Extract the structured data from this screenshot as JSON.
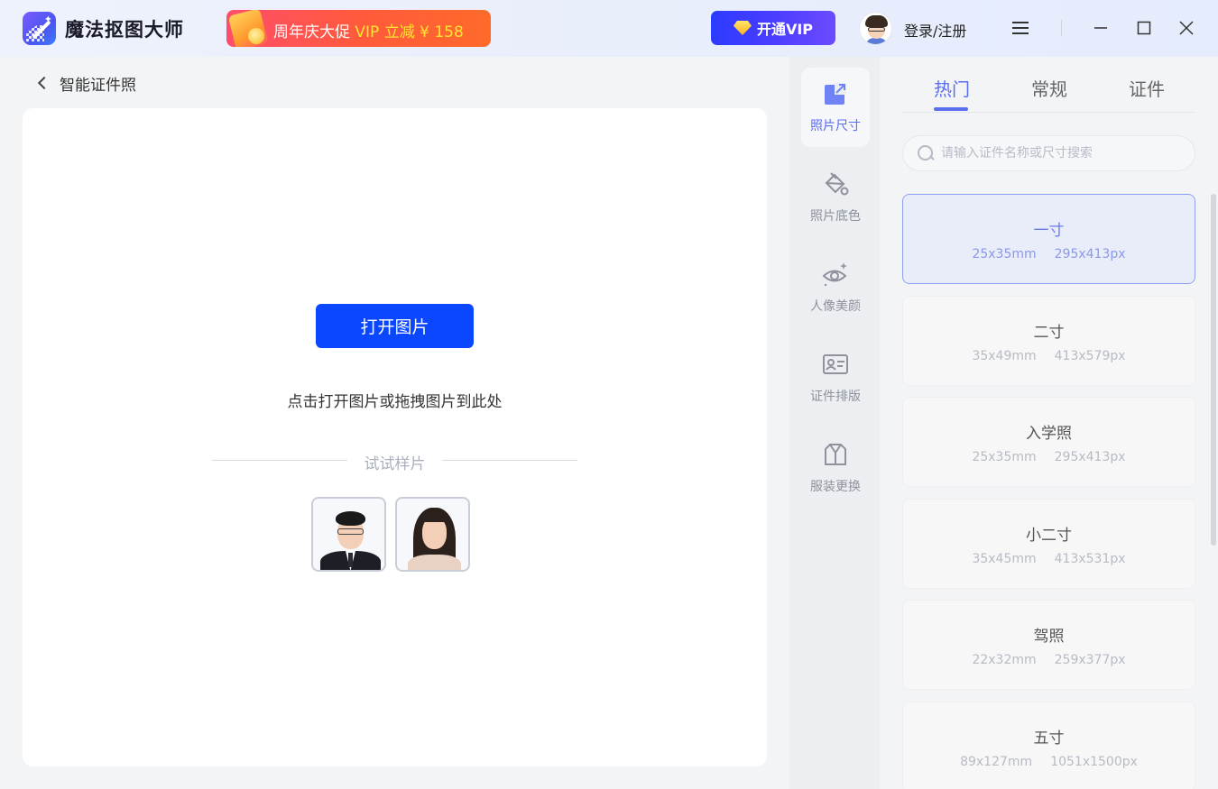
{
  "app": {
    "title": "魔法抠图大师",
    "promo_prefix": "周年庆大促",
    "promo_highlight": "VIP 立减 ¥ 158",
    "vip_button": "开通VIP",
    "login": "登录/注册"
  },
  "nav": {
    "back_label": "智能证件照"
  },
  "canvas": {
    "open_button": "打开图片",
    "hint": "点击打开图片或拖拽图片到此处",
    "samples_label": "试试样片"
  },
  "tools": [
    {
      "label": "照片尺寸",
      "icon": "photo-size-icon",
      "active": true
    },
    {
      "label": "照片底色",
      "icon": "paint-bucket-icon",
      "active": false
    },
    {
      "label": "人像美颜",
      "icon": "eye-sparkle-icon",
      "active": false
    },
    {
      "label": "证件排版",
      "icon": "id-card-icon",
      "active": false
    },
    {
      "label": "服装更换",
      "icon": "clothing-icon",
      "active": false
    }
  ],
  "tabs": [
    "热门",
    "常规",
    "证件"
  ],
  "search": {
    "placeholder": "请输入证件名称或尺寸搜索"
  },
  "sizes": [
    {
      "name": "一寸",
      "mm": "25x35mm",
      "px": "295x413px"
    },
    {
      "name": "二寸",
      "mm": "35x49mm",
      "px": "413x579px"
    },
    {
      "name": "入学照",
      "mm": "25x35mm",
      "px": "295x413px"
    },
    {
      "name": "小二寸",
      "mm": "35x45mm",
      "px": "413x531px"
    },
    {
      "name": "驾照",
      "mm": "22x32mm",
      "px": "259x377px"
    },
    {
      "name": "五寸",
      "mm": "89x127mm",
      "px": "1051x1500px"
    }
  ],
  "colors": {
    "accent": "#5b6ef0",
    "primary_button": "#0a47ff",
    "promo": "#ff5a3c"
  }
}
